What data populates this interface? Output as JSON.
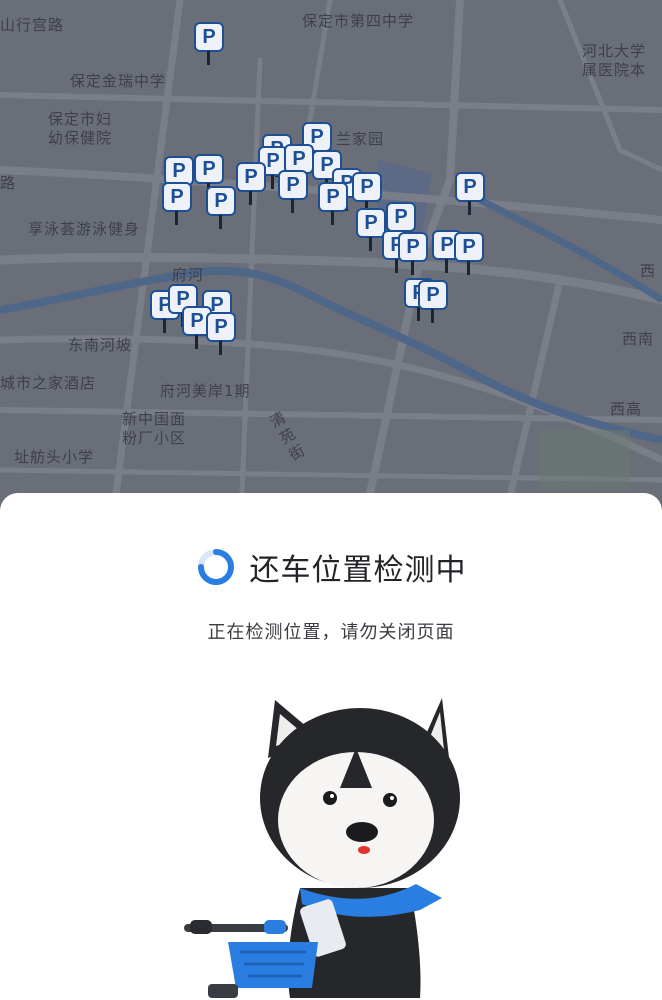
{
  "map": {
    "labels": [
      {
        "id": "shanxinggong-road",
        "text": "山行宫路"
      },
      {
        "id": "baoding-no4-middle-school",
        "text": "保定市第四中学"
      },
      {
        "id": "baoding-jinrui-middle-school",
        "text": "保定金瑞中学"
      },
      {
        "id": "hebei-university-hospital",
        "text": "河北大学\n属医院本"
      },
      {
        "id": "baoding-maternal-child",
        "text": "保定市妇\n幼保健院"
      },
      {
        "id": "road-fragment-left",
        "text": "路"
      },
      {
        "id": "wang-jia-yuan",
        "text": "兰家园"
      },
      {
        "id": "xiangyong-swimming",
        "text": "享泳荟游泳健身"
      },
      {
        "id": "fuhe-label",
        "text": "府河"
      },
      {
        "id": "xi-fragment-1",
        "text": "西"
      },
      {
        "id": "dongnan-hepo",
        "text": "东南河坡"
      },
      {
        "id": "xinan-fragment",
        "text": "西南"
      },
      {
        "id": "chengshi-hotel",
        "text": "城市之家酒店"
      },
      {
        "id": "fuhe-meian",
        "text": "府河美岸1期"
      },
      {
        "id": "xigao-fragment",
        "text": "西高"
      },
      {
        "id": "xinzhongguo-fangchang",
        "text": "新中国面\n粉厂小区"
      },
      {
        "id": "zhaofangtou-school",
        "text": "址舫头小学"
      },
      {
        "id": "road-vertical",
        "text": "清\n苑\n街"
      }
    ],
    "parking_marker_text": "P"
  },
  "sheet": {
    "status_title": "还车位置检测中",
    "status_subtitle": "正在检测位置，请勿关闭页面"
  },
  "colors": {
    "map_bg": "#6a6e79",
    "river": "#4e6688",
    "marker_blue": "#1d4f94",
    "spinner_blue": "#2a7de1"
  },
  "icons": {
    "spinner": "loading-spinner-icon",
    "mascot": "husky-mascot-with-bike"
  }
}
